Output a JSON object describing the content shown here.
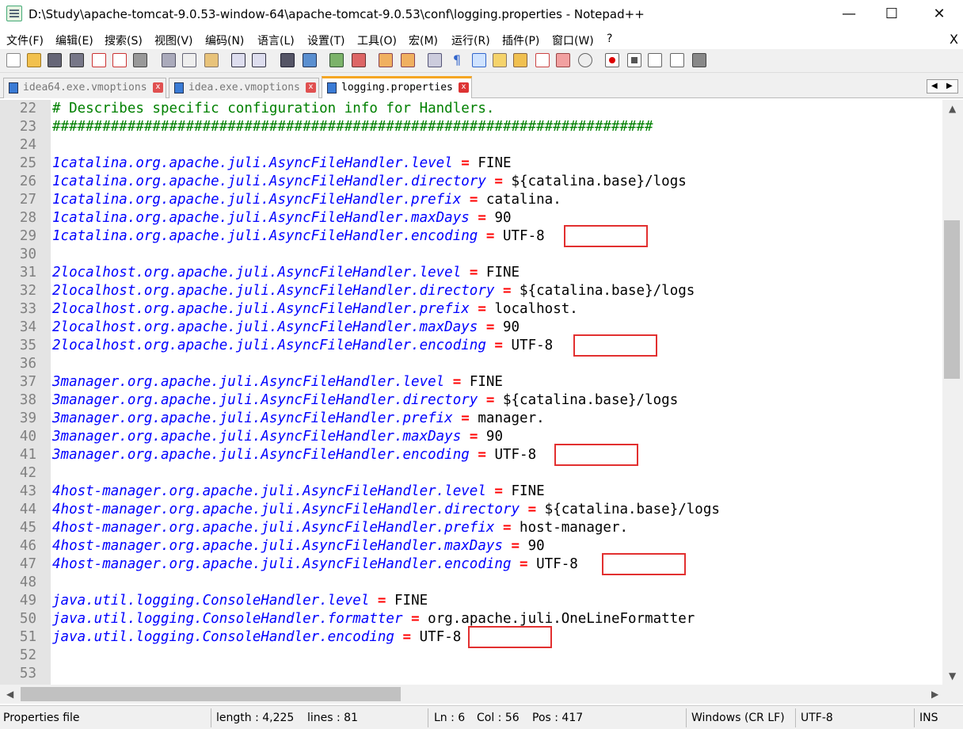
{
  "window": {
    "title": "D:\\Study\\apache-tomcat-9.0.53-window-64\\apache-tomcat-9.0.53\\conf\\logging.properties - Notepad++",
    "minimize": "—",
    "maximize": "☐",
    "close": "✕"
  },
  "menu": [
    "文件(F)",
    "编辑(E)",
    "搜索(S)",
    "视图(V)",
    "编码(N)",
    "语言(L)",
    "设置(T)",
    "工具(O)",
    "宏(M)",
    "运行(R)",
    "插件(P)",
    "窗口(W)",
    "?"
  ],
  "menu_close": "X",
  "tabs": [
    {
      "label": "idea64.exe.vmoptions",
      "active": false
    },
    {
      "label": "idea.exe.vmoptions",
      "active": false
    },
    {
      "label": "logging.properties",
      "active": true
    }
  ],
  "tab_close": "x",
  "editor": {
    "lines": [
      {
        "n": "22",
        "type": "comment",
        "text": "# Describes specific configuration info for Handlers."
      },
      {
        "n": "23",
        "type": "comment",
        "text": "########################################################################"
      },
      {
        "n": "24",
        "type": "blank"
      },
      {
        "n": "25",
        "type": "prop",
        "key": "1catalina.org.apache.juli.AsyncFileHandler.level",
        "value": "FINE"
      },
      {
        "n": "26",
        "type": "prop",
        "key": "1catalina.org.apache.juli.AsyncFileHandler.directory",
        "value": "${catalina.base}/logs"
      },
      {
        "n": "27",
        "type": "prop",
        "key": "1catalina.org.apache.juli.AsyncFileHandler.prefix",
        "value": "catalina."
      },
      {
        "n": "28",
        "type": "prop",
        "key": "1catalina.org.apache.juli.AsyncFileHandler.maxDays",
        "value": "90"
      },
      {
        "n": "29",
        "type": "prop",
        "key": "1catalina.org.apache.juli.AsyncFileHandler.encoding",
        "value": "UTF-8",
        "highlight": true
      },
      {
        "n": "30",
        "type": "blank"
      },
      {
        "n": "31",
        "type": "prop",
        "key": "2localhost.org.apache.juli.AsyncFileHandler.level",
        "value": "FINE"
      },
      {
        "n": "32",
        "type": "prop",
        "key": "2localhost.org.apache.juli.AsyncFileHandler.directory",
        "value": "${catalina.base}/logs"
      },
      {
        "n": "33",
        "type": "prop",
        "key": "2localhost.org.apache.juli.AsyncFileHandler.prefix",
        "value": "localhost."
      },
      {
        "n": "34",
        "type": "prop",
        "key": "2localhost.org.apache.juli.AsyncFileHandler.maxDays",
        "value": "90"
      },
      {
        "n": "35",
        "type": "prop",
        "key": "2localhost.org.apache.juli.AsyncFileHandler.encoding",
        "value": "UTF-8",
        "highlight": true
      },
      {
        "n": "36",
        "type": "blank"
      },
      {
        "n": "37",
        "type": "prop",
        "key": "3manager.org.apache.juli.AsyncFileHandler.level",
        "value": "FINE"
      },
      {
        "n": "38",
        "type": "prop",
        "key": "3manager.org.apache.juli.AsyncFileHandler.directory",
        "value": "${catalina.base}/logs"
      },
      {
        "n": "39",
        "type": "prop",
        "key": "3manager.org.apache.juli.AsyncFileHandler.prefix",
        "value": "manager."
      },
      {
        "n": "40",
        "type": "prop",
        "key": "3manager.org.apache.juli.AsyncFileHandler.maxDays",
        "value": "90"
      },
      {
        "n": "41",
        "type": "prop",
        "key": "3manager.org.apache.juli.AsyncFileHandler.encoding",
        "value": "UTF-8",
        "highlight": true
      },
      {
        "n": "42",
        "type": "blank"
      },
      {
        "n": "43",
        "type": "prop",
        "key": "4host-manager.org.apache.juli.AsyncFileHandler.level",
        "value": "FINE"
      },
      {
        "n": "44",
        "type": "prop",
        "key": "4host-manager.org.apache.juli.AsyncFileHandler.directory",
        "value": "${catalina.base}/logs"
      },
      {
        "n": "45",
        "type": "prop",
        "key": "4host-manager.org.apache.juli.AsyncFileHandler.prefix",
        "value": "host-manager."
      },
      {
        "n": "46",
        "type": "prop",
        "key": "4host-manager.org.apache.juli.AsyncFileHandler.maxDays",
        "value": "90"
      },
      {
        "n": "47",
        "type": "prop",
        "key": "4host-manager.org.apache.juli.AsyncFileHandler.encoding",
        "value": "UTF-8",
        "highlight": true
      },
      {
        "n": "48",
        "type": "blank"
      },
      {
        "n": "49",
        "type": "prop",
        "key": "java.util.logging.ConsoleHandler.level",
        "value": "FINE"
      },
      {
        "n": "50",
        "type": "prop",
        "key": "java.util.logging.ConsoleHandler.formatter",
        "value": "org.apache.juli.OneLineFormatter"
      },
      {
        "n": "51",
        "type": "prop",
        "key": "java.util.logging.ConsoleHandler.encoding",
        "value": "UTF-8",
        "highlight": true
      },
      {
        "n": "52",
        "type": "blank"
      },
      {
        "n": "53",
        "type": "blank"
      }
    ]
  },
  "status": {
    "file_type": "Properties file",
    "length": "length : 4,225",
    "lines": "lines : 81",
    "ln": "Ln : 6",
    "col": "Col : 56",
    "pos": "Pos : 417",
    "eol": "Windows (CR LF)",
    "encoding": "UTF-8",
    "mode": "INS"
  },
  "colors": {
    "comment": "#008000",
    "key": "#0000ff",
    "operator": "#ff0000",
    "highlight_box": "#e23030",
    "active_tab_accent": "#f5a623"
  },
  "toolbar_icons": [
    "new-file-icon",
    "open-file-icon",
    "save-icon",
    "save-all-icon",
    "close-icon",
    "close-all-icon",
    "print-icon",
    "cut-icon",
    "copy-icon",
    "paste-icon",
    "undo-icon",
    "redo-icon",
    "find-icon",
    "replace-icon",
    "zoom-in-icon",
    "zoom-out-icon",
    "sync-vertical-icon",
    "sync-horizontal-icon",
    "word-wrap-icon",
    "show-all-chars-icon",
    "indent-guide-icon",
    "doc-map-icon",
    "function-list-icon",
    "folder-workspace-icon",
    "monitoring-icon",
    "macro-record-icon",
    "macro-stop-icon",
    "macro-play-icon",
    "macro-run-multiple-icon",
    "macro-save-icon"
  ]
}
